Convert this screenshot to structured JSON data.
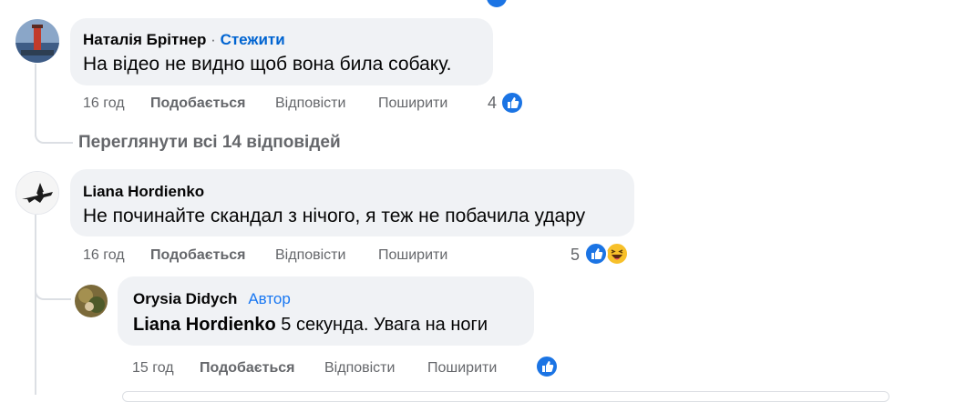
{
  "comments": [
    {
      "author": "Наталія Брітнер",
      "follow_label": "Стежити",
      "separator": "·",
      "text": "На відео не видно щоб вона била собаку.",
      "time": "16 год",
      "like_label": "Подобається",
      "reply_label": "Відповісти",
      "share_label": "Поширити",
      "reaction_count": "4"
    },
    {
      "author": "Liana Hordienko",
      "text": "Не починайте скандал з нічого, я теж не побачила удару",
      "time": "16 год",
      "like_label": "Подобається",
      "reply_label": "Відповісти",
      "share_label": "Поширити",
      "reaction_count": "5"
    }
  ],
  "view_replies_label": "Переглянути всі 14 відповідей",
  "reply": {
    "author": "Orysia Didych",
    "badge": "Автор",
    "mention": "Liana Hordienko",
    "text": "5 секунда. Увага на ноги",
    "time": "15 год",
    "like_label": "Подобається",
    "reply_label": "Відповісти",
    "share_label": "Поширити"
  },
  "colors": {
    "bubble_bg": "#f0f2f5",
    "meta_text": "#65676b",
    "like_blue": "#1b74e4",
    "follow_blue": "#0064d1",
    "haha_yellow": "#f7c02a"
  },
  "icons": [
    "like-reaction-icon",
    "haha-reaction-icon"
  ]
}
